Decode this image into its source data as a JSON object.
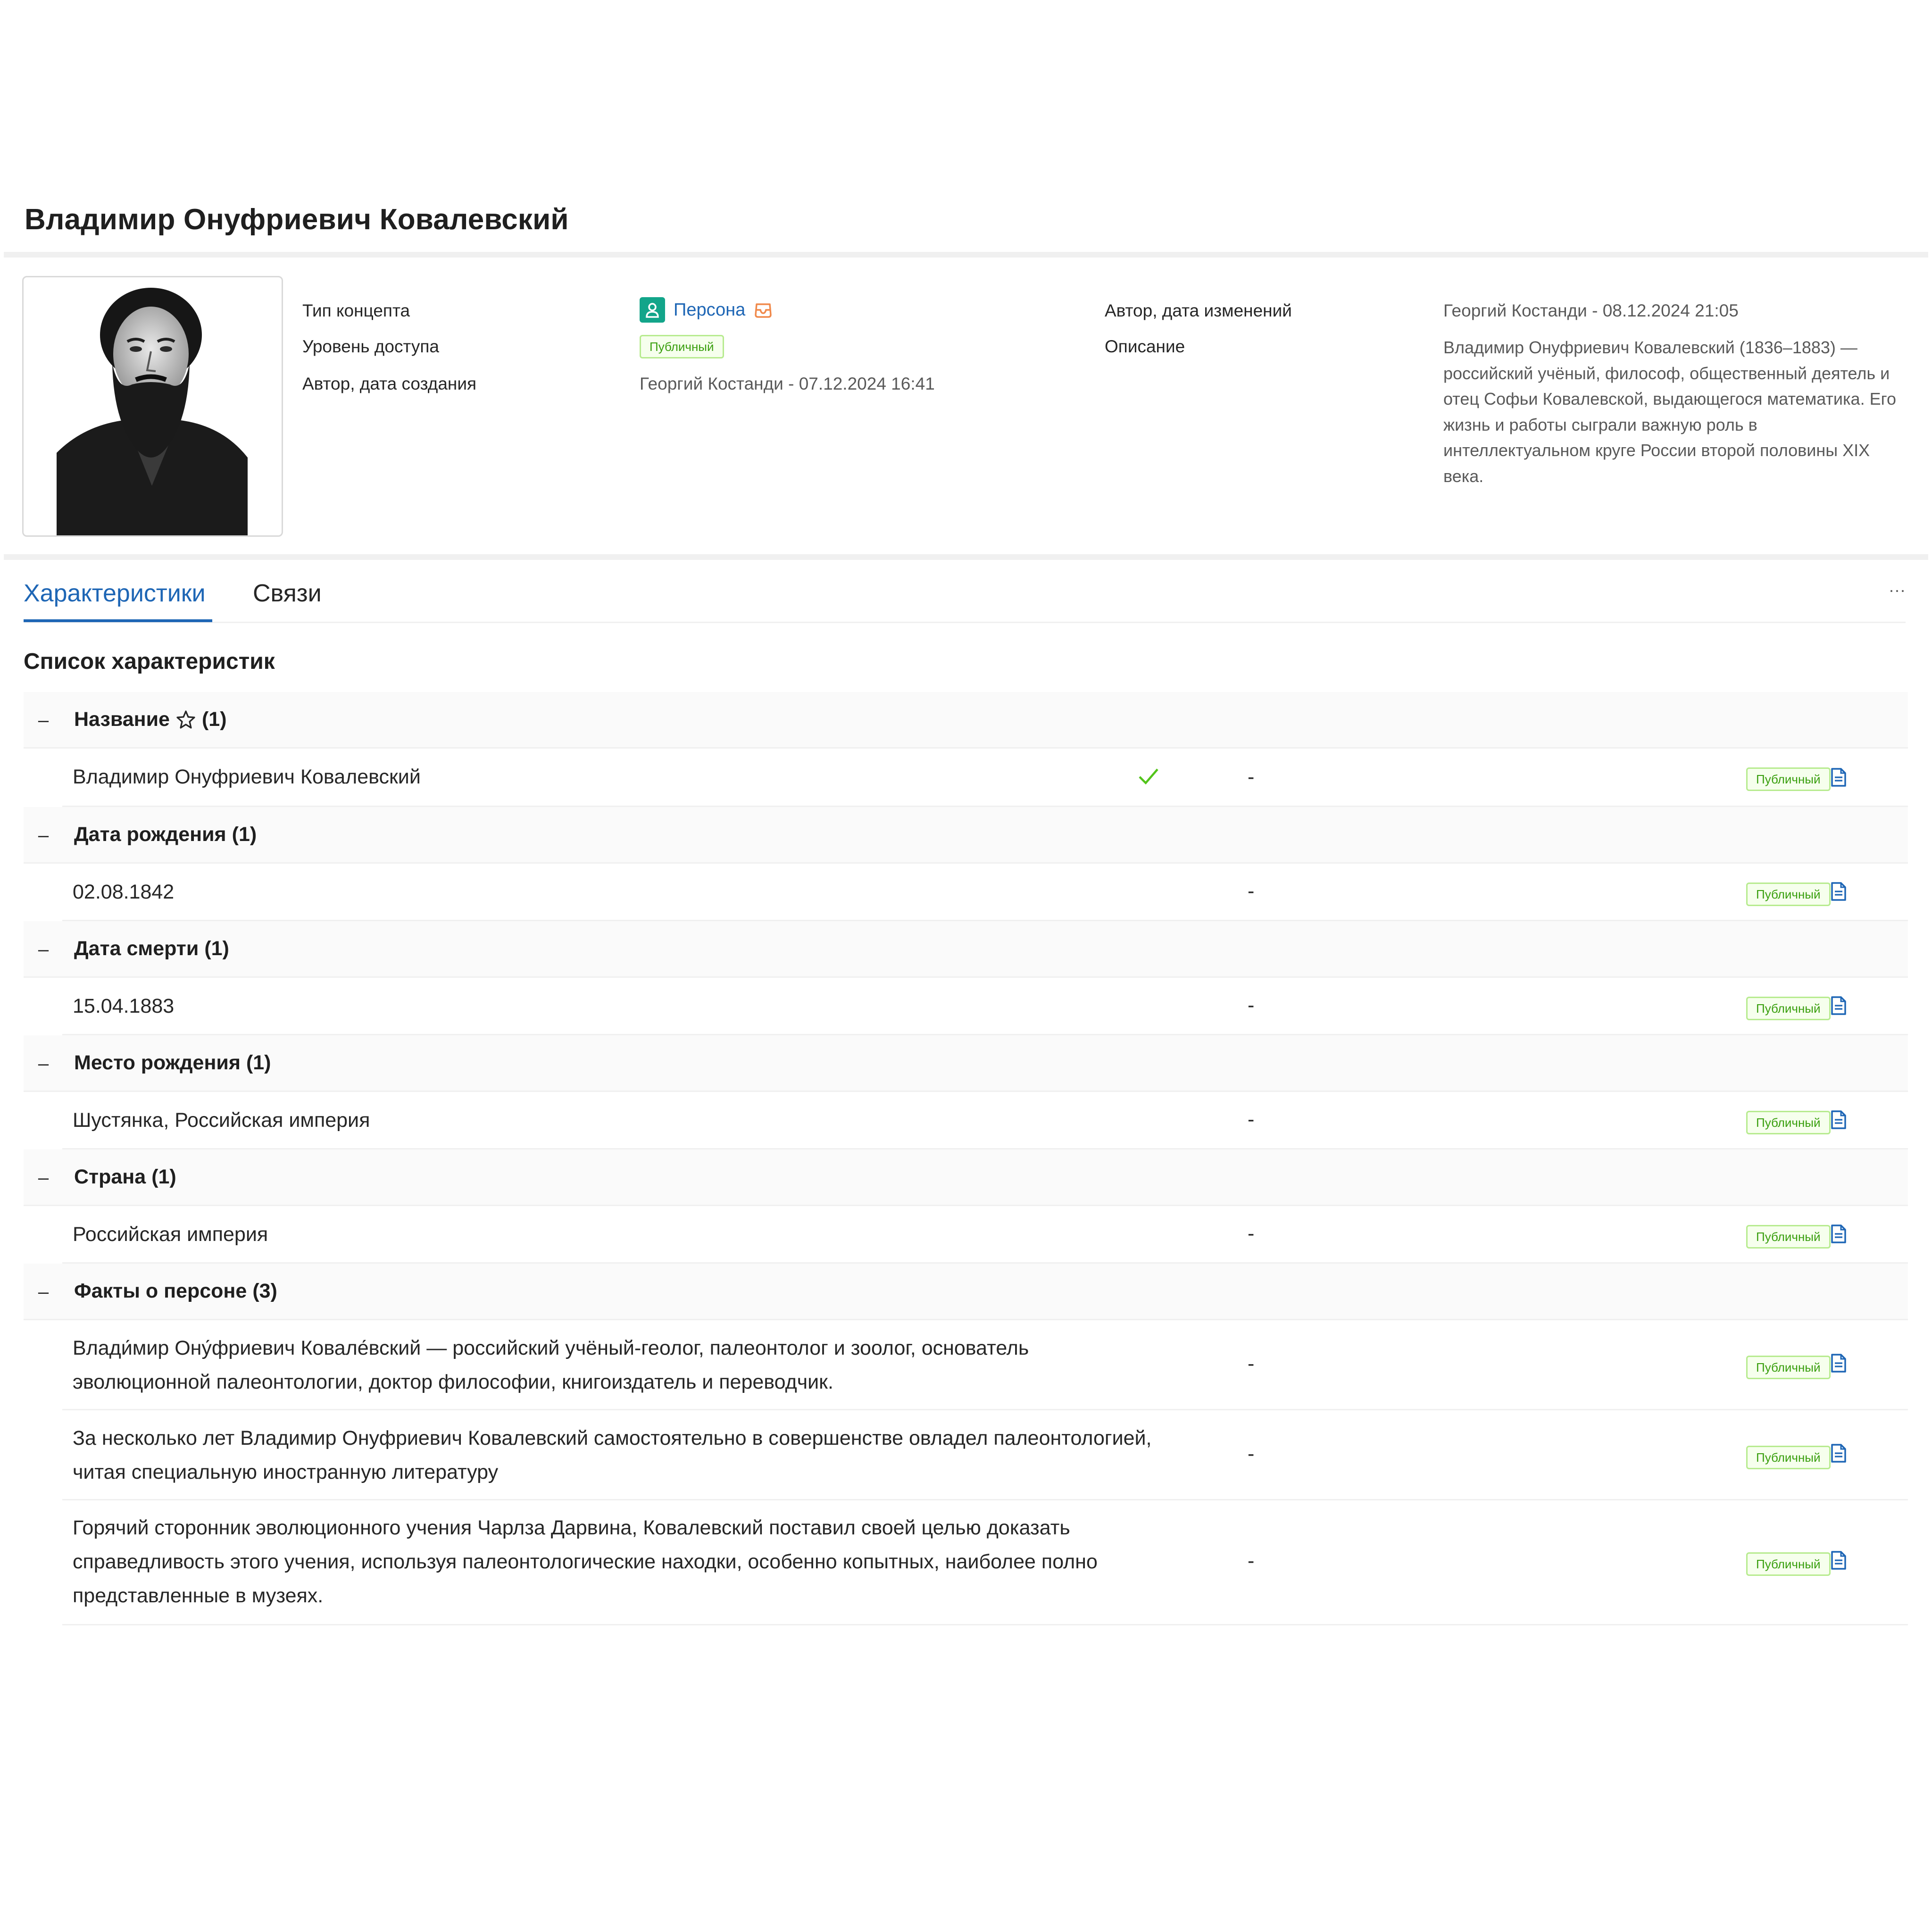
{
  "page": {
    "title": "Владимир Онуфриевич Ковалевский"
  },
  "info": {
    "concept_type_label": "Тип концепта",
    "concept_type_value": "Персона",
    "access_level_label": "Уровень доступа",
    "access_level_value": "Публичный",
    "created_label": "Автор, дата создания",
    "created_value": "Георгий  Костанди - 07.12.2024 16:41",
    "modified_label": "Автор, дата изменений",
    "modified_value": "Георгий  Костанди - 08.12.2024 21:05",
    "description_label": "Описание",
    "description_value": "Владимир Онуфриевич Ковалевский (1836–1883) — российский учёный, философ, общественный деятель и отец Софьи Ковалевской, выдающегося математика. Его жизнь и работы сыграли важную роль в интеллектуальном круге России второй половины XIX века."
  },
  "tabs": {
    "characteristics": "Характеристики",
    "links": "Связи",
    "more": "···"
  },
  "list": {
    "title": "Список характеристик",
    "collapse_symbol": "–",
    "groups": [
      {
        "name": "Название",
        "count": "(1)",
        "values": [
          {
            "text": "Владимир Онуфриевич Ковалевский",
            "dash": "-",
            "access": "Публичный"
          }
        ]
      },
      {
        "name": "Дата рождения",
        "count": "(1)",
        "values": [
          {
            "text": "02.08.1842",
            "dash": "-",
            "access": "Публичный"
          }
        ]
      },
      {
        "name": "Дата смерти",
        "count": "(1)",
        "values": [
          {
            "text": "15.04.1883",
            "dash": "-",
            "access": "Публичный"
          }
        ]
      },
      {
        "name": "Место рождения",
        "count": "(1)",
        "values": [
          {
            "text": "Шустянка, Российская империя",
            "dash": "-",
            "access": "Публичный"
          }
        ]
      },
      {
        "name": "Страна",
        "count": "(1)",
        "values": [
          {
            "text": "Российская империя",
            "dash": "-",
            "access": "Публичный"
          }
        ]
      },
      {
        "name": "Факты о персоне",
        "count": "(3)",
        "values": [
          {
            "text": "Влади́мир Ону́фриевич Ковале́вский — российский учёный-геолог, палеонтолог и зоолог, основатель эволюционной палеонтологии, доктор философии, книгоиздатель и переводчик.",
            "dash": "-",
            "access": "Публичный"
          },
          {
            "text": "За несколько лет Владимир Онуфриевич Ковалевский самостоятельно в совершенстве овладел палеонтологией, читая специальную иностранную литературу",
            "dash": "-",
            "access": "Публичный"
          },
          {
            "text": "Горячий сторонник эволюционного учения Чарлза Дарвина, Ковалевский поставил своей целью доказать справедливость этого учения, используя палеонтологические находки, особенно копытных, наиболее полно представленные в музеях.",
            "dash": "-",
            "access": "Публичный"
          }
        ]
      }
    ]
  },
  "colors": {
    "accent": "#1e66b5",
    "person_icon": "#13a58a",
    "tag_border": "#b7eb8f",
    "tag_text": "#389e0d",
    "check": "#52c41a",
    "inbox_icon": "#f0894b"
  },
  "icons": {
    "person": "person-icon",
    "inbox": "inbox-icon",
    "star": "star-icon",
    "check": "check-icon",
    "document": "document-icon",
    "more": "ellipsis-icon"
  }
}
